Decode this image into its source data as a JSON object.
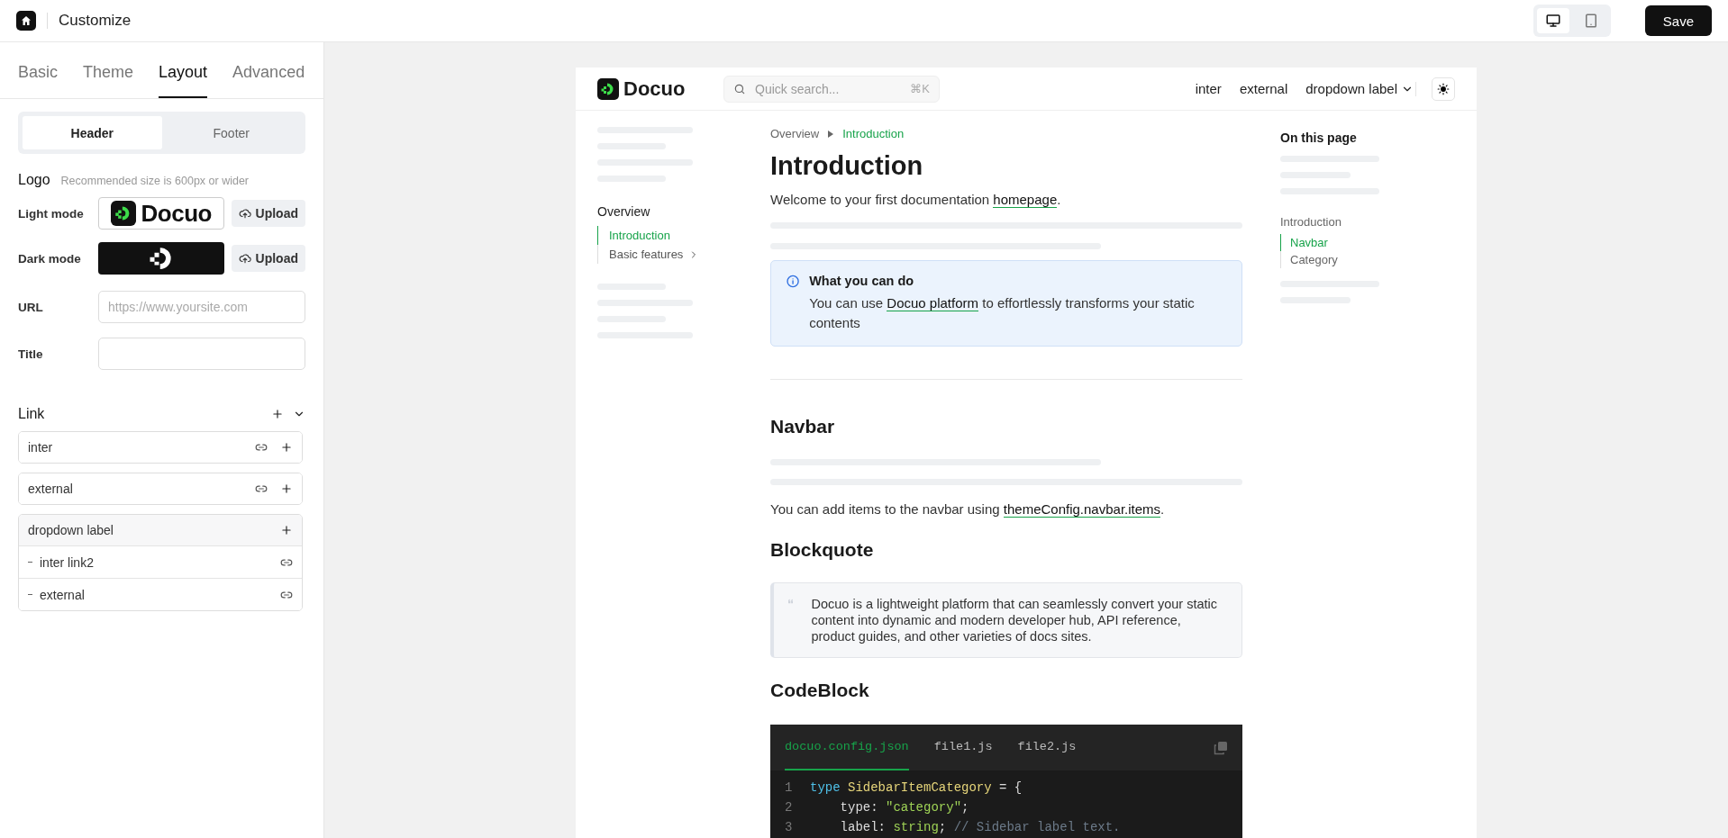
{
  "topbar": {
    "title": "Customize",
    "devices": [
      {
        "kind": "desktop",
        "selected": true
      },
      {
        "kind": "tablet",
        "selected": false
      }
    ],
    "save": "Save"
  },
  "panel": {
    "tabs": [
      {
        "label": "Basic",
        "selected": false
      },
      {
        "label": "Theme",
        "selected": false
      },
      {
        "label": "Layout",
        "selected": true
      },
      {
        "label": "Advanced",
        "selected": false
      }
    ],
    "segments": [
      {
        "label": "Header",
        "selected": true
      },
      {
        "label": "Footer",
        "selected": false
      }
    ],
    "logo": {
      "label": "Logo",
      "hint": "Recommended size is 600px or wider",
      "modes": [
        {
          "label": "Light mode",
          "kind": "light",
          "logo_text": "Docuo",
          "upload": "Upload"
        },
        {
          "label": "Dark mode",
          "kind": "dark",
          "upload": "Upload"
        }
      ]
    },
    "fields": [
      {
        "label": "URL",
        "placeholder": "https://www.yoursite.com"
      },
      {
        "label": "Title"
      }
    ],
    "links": {
      "label": "Link",
      "items": [
        {
          "label": "inter",
          "kind": "link"
        },
        {
          "label": "external",
          "kind": "link"
        },
        {
          "label": "dropdown label",
          "kind": "dropdown",
          "children": [
            {
              "label": "inter link2"
            },
            {
              "label": "external"
            }
          ]
        }
      ]
    }
  },
  "preview": {
    "navbar": {
      "logo_text": "Docuo",
      "search_placeholder": "Quick search...",
      "shortcut": "⌘K",
      "links": [
        {
          "label": "inter",
          "kind": "link"
        },
        {
          "label": "external",
          "kind": "link"
        },
        {
          "label": "dropdown label",
          "kind": "dropdown"
        }
      ]
    },
    "sidebar": {
      "section": "Overview",
      "items": [
        {
          "label": "Introduction",
          "selected": true,
          "has_children": false
        },
        {
          "label": "Basic features",
          "selected": false,
          "has_children": true
        }
      ]
    },
    "breadcrumb": [
      {
        "label": "Overview",
        "current": false
      },
      {
        "label": "Introduction",
        "current": true
      }
    ],
    "title": "Introduction",
    "intro": {
      "before": "Welcome to your first documentation ",
      "link": "homepage",
      "after": "."
    },
    "callout": {
      "title": "What you can do",
      "body": {
        "before": "You can use ",
        "link": "Docuo platform",
        "after": " to effortlessly transforms your static contents"
      }
    },
    "navbar_section": {
      "heading": "Navbar",
      "body": {
        "before": "You can add items to the navbar using ",
        "link": "themeConfig.navbar.items",
        "after": "."
      }
    },
    "blockquote_section": {
      "heading": "Blockquote",
      "quote": "Docuo is a lightweight platform that can seamlessly convert your static content into dynamic and modern developer hub, API reference, product guides, and other varieties of docs sites."
    },
    "code_section": {
      "heading": "CodeBlock",
      "tabs": [
        {
          "label": "docuo.config.json",
          "selected": true
        },
        {
          "label": "file1.js",
          "selected": false
        },
        {
          "label": "file2.js",
          "selected": false
        }
      ],
      "lines": [
        {
          "number": "1",
          "tokens": [
            {
              "kind": "keyword",
              "text": "type"
            },
            {
              "kind": "type",
              "text": " SidebarItemCategory"
            },
            {
              "kind": "plain",
              "text": " = {"
            }
          ]
        },
        {
          "number": "2",
          "tokens": [
            {
              "kind": "plain",
              "text": "    type: "
            },
            {
              "kind": "string",
              "text": "\"category\""
            },
            {
              "kind": "plain",
              "text": ";"
            }
          ]
        },
        {
          "number": "3",
          "tokens": [
            {
              "kind": "plain",
              "text": "    label: "
            },
            {
              "kind": "string",
              "text": "string"
            },
            {
              "kind": "plain",
              "text": "; "
            },
            {
              "kind": "comment",
              "text": "// Sidebar label text."
            }
          ]
        }
      ]
    },
    "toc": {
      "title": "On this page",
      "items": [
        {
          "label": "Introduction",
          "selected": false,
          "children": [
            {
              "label": "Navbar",
              "selected": true
            },
            {
              "label": "Category",
              "selected": false
            }
          ]
        }
      ]
    }
  }
}
